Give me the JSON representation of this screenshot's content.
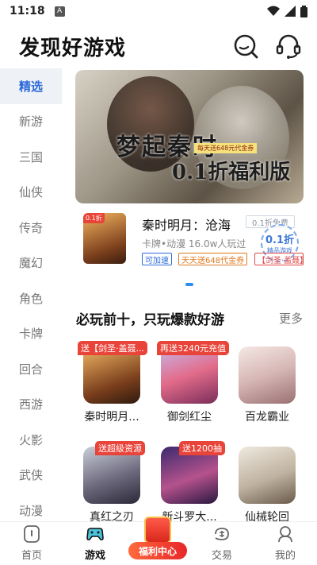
{
  "status_bar": {
    "time": "11:18",
    "badge": "A"
  },
  "header": {
    "title": "发现好游戏",
    "search_icon": "search-icon",
    "service_icon": "headset-icon"
  },
  "sidebar": {
    "items": [
      {
        "label": "精选",
        "active": true
      },
      {
        "label": "新游"
      },
      {
        "label": "三国"
      },
      {
        "label": "仙侠"
      },
      {
        "label": "传奇"
      },
      {
        "label": "魔幻"
      },
      {
        "label": "角色"
      },
      {
        "label": "卡牌"
      },
      {
        "label": "回合"
      },
      {
        "label": "西游"
      },
      {
        "label": "火影"
      },
      {
        "label": "武侠"
      },
      {
        "label": "动漫"
      }
    ]
  },
  "banner": {
    "title": "梦起秦时",
    "subtitle": "0.1折福利版",
    "tag": "每天送648元代金券"
  },
  "featured_game": {
    "name": "秦时明月：沧海",
    "meta": "卡牌•动漫  16.0w人玩过",
    "discount_label": "0.1折免费",
    "seal_main": "0.1折",
    "seal_sub": "精品游戏",
    "icon_badge": "0.1折",
    "tags": [
      "可加速",
      "天天送648代金券",
      "【剑圣·盖聂】"
    ]
  },
  "section": {
    "title": "必玩前十，只玩爆款好游",
    "more": "更多"
  },
  "top_games": [
    {
      "name": "秦时明月...",
      "ribbon": "送【剑圣·盖聂..."
    },
    {
      "name": "御剑红尘",
      "ribbon": "再送3240元充值"
    },
    {
      "name": "百龙霸业",
      "ribbon": ""
    },
    {
      "name": "真红之刃",
      "ribbon": "送超级资源"
    },
    {
      "name": "新斗罗大...",
      "ribbon": "送1200抽"
    },
    {
      "name": "仙械轮回",
      "ribbon": ""
    }
  ],
  "bottom_nav": {
    "items": [
      {
        "label": "首页"
      },
      {
        "label": "游戏",
        "active": true
      },
      {
        "label": "交易"
      },
      {
        "label": "我的"
      }
    ],
    "center_label": "福利中心"
  },
  "colors": {
    "accent": "#2d6bd9",
    "red": "#e8443a",
    "sidebar_active_bg": "#eef1f6"
  }
}
